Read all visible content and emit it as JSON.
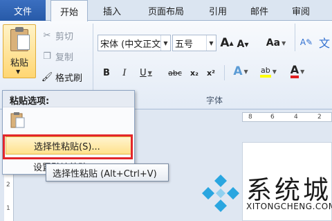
{
  "tabs": {
    "file": "文件",
    "items": [
      "开始",
      "插入",
      "页面布局",
      "引用",
      "邮件",
      "审阅"
    ]
  },
  "clipboard": {
    "paste": "粘贴",
    "cut": "剪切",
    "copy": "复制",
    "format_painter": "格式刷"
  },
  "font": {
    "font_name": "宋体 (中文正文",
    "font_size": "五号",
    "group_label": "字体",
    "bold": "B",
    "italic": "I",
    "underline": "U",
    "strikethrough": "abc",
    "subscript": "x₂",
    "superscript": "x²",
    "grow": "A",
    "shrink": "A",
    "change_case": "Aa",
    "text_effect": "A",
    "highlight": "ab",
    "font_color": "A",
    "phonetic": "文"
  },
  "ruler": {
    "top_ticks": [
      "8",
      "6",
      "4",
      "2"
    ],
    "left_ticks": [
      "2",
      "1"
    ]
  },
  "paste_menu": {
    "header": "粘贴选项:",
    "paste_special": "选择性粘贴(S)...",
    "default_paste_partial": "设置默认粘贴"
  },
  "tooltip": {
    "text": "选择性粘贴 (Alt+Ctrl+V)"
  },
  "watermark": {
    "name": "系统城",
    "site": "XITONGCHENG.COM"
  },
  "colors": {
    "file_tab": "#2b5fab",
    "highlight_frame": "#e3262a",
    "menu_highlight": "#ffe18c",
    "watermark_blue": "#2aa6e0"
  }
}
